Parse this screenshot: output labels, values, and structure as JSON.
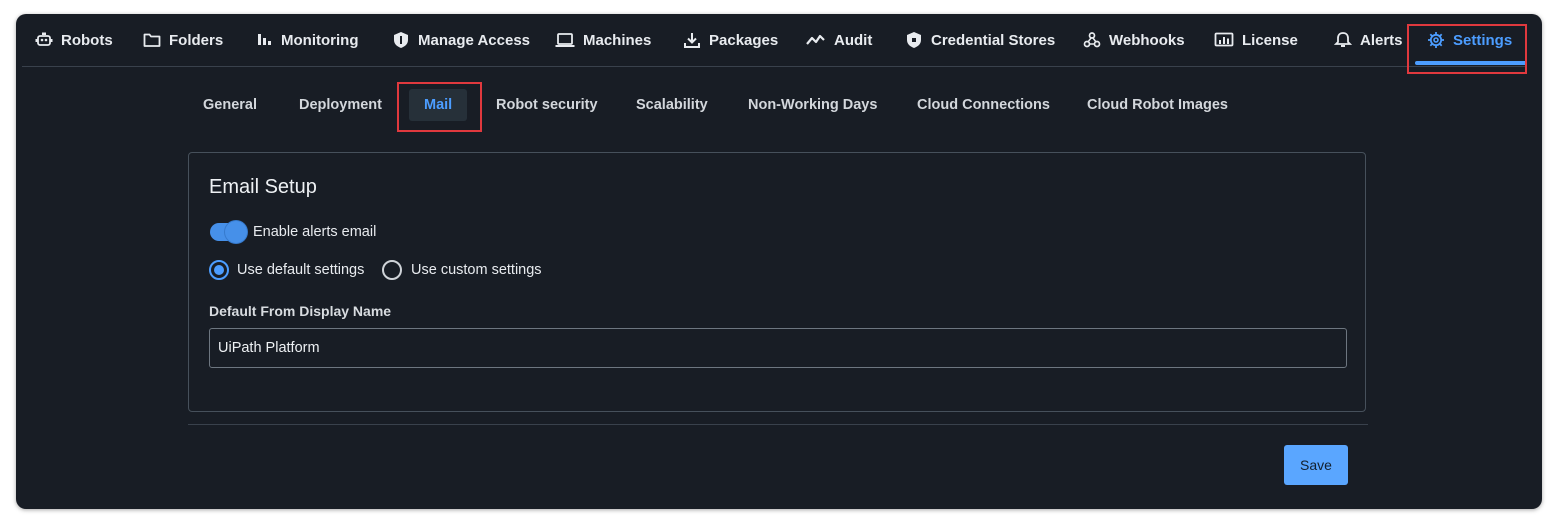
{
  "nav": {
    "robots": "Robots",
    "folders": "Folders",
    "monitoring": "Monitoring",
    "manage_access": "Manage Access",
    "machines": "Machines",
    "packages": "Packages",
    "audit": "Audit",
    "credential_stores": "Credential Stores",
    "webhooks": "Webhooks",
    "license": "License",
    "alerts": "Alerts",
    "settings": "Settings",
    "active": "Settings"
  },
  "subtabs": {
    "general": "General",
    "deployment": "Deployment",
    "mail": "Mail",
    "robot_security": "Robot security",
    "scalability": "Scalability",
    "non_working_days": "Non-Working Days",
    "cloud_connections": "Cloud Connections",
    "cloud_robot_images": "Cloud Robot Images",
    "active": "Mail"
  },
  "email_setup": {
    "title": "Email Setup",
    "enable_alerts_label": "Enable alerts email",
    "enable_alerts_on": true,
    "default_settings_label": "Use default settings",
    "custom_settings_label": "Use custom settings",
    "selected_option": "Use default settings",
    "display_name_label": "Default From Display Name",
    "display_name_value": "UiPath Platform"
  },
  "actions": {
    "save": "Save"
  },
  "colors": {
    "background": "#181d25",
    "accent": "#4c9dff",
    "highlight": "#e0393e",
    "text": "#e8ebef"
  }
}
